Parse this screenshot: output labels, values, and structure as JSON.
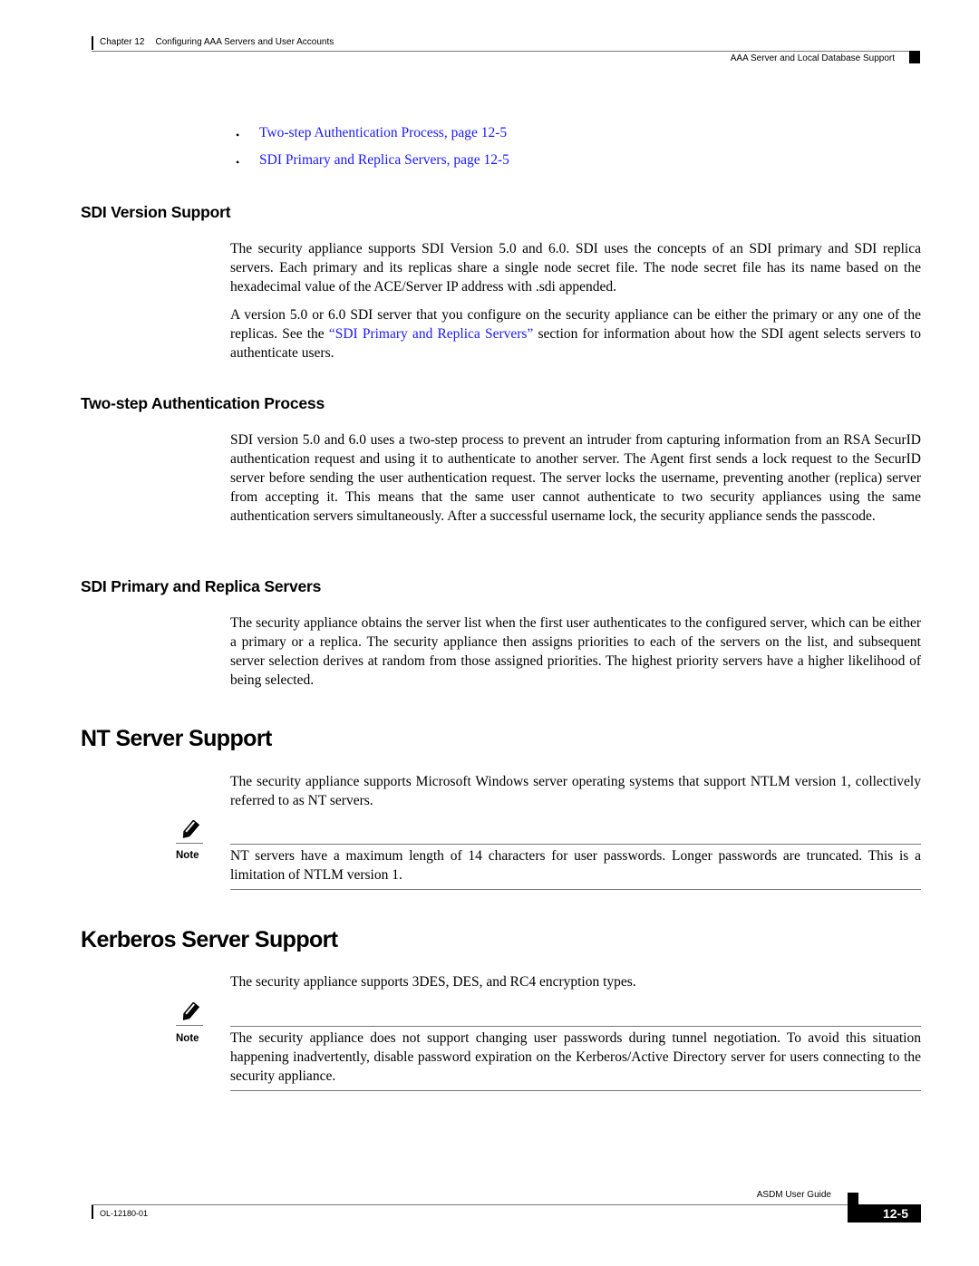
{
  "header": {
    "chapter_label": "Chapter 12",
    "chapter_title": "Configuring AAA Servers and User Accounts",
    "section_title": "AAA Server and Local Database Support"
  },
  "bullets": [
    {
      "text": "Two-step Authentication Process, page 12-5"
    },
    {
      "text": "SDI Primary and Replica Servers, page 12-5"
    }
  ],
  "sections": {
    "sdi_version": {
      "heading": "SDI Version Support",
      "para1": "The security appliance supports SDI Version 5.0 and 6.0. SDI uses the concepts of an SDI primary and SDI replica servers. Each primary and its replicas share a single node secret file. The node secret file has its name based on the hexadecimal value of the ACE/Server IP address with .sdi appended.",
      "para2_before": "A version 5.0 or 6.0 SDI server that you configure on the security appliance can be either the primary or any one of the replicas. See the ",
      "para2_link": "“SDI Primary and Replica Servers”",
      "para2_after": " section for information about how the SDI agent selects servers to authenticate users."
    },
    "two_step": {
      "heading": "Two-step Authentication Process",
      "para": "SDI version 5.0 and 6.0 uses a two-step process to prevent an intruder from capturing information from an RSA SecurID authentication request and using it to authenticate to another server. The Agent first sends a lock request to the SecurID server before sending the user authentication request. The server locks the username, preventing another (replica) server from accepting it. This means that the same user cannot authenticate to two security appliances using the same authentication servers simultaneously. After a successful username lock, the security appliance sends the passcode."
    },
    "sdi_primary": {
      "heading": "SDI Primary and Replica Servers",
      "para": "The security appliance obtains the server list when the first user authenticates to the configured server, which can be either a primary or a replica. The security appliance then assigns priorities to each of the servers on the list, and subsequent server selection derives at random from those assigned priorities. The highest priority servers have a higher likelihood of being selected."
    },
    "nt_server": {
      "heading": "NT Server Support",
      "para": "The security appliance supports Microsoft Windows server operating systems that support NTLM version 1, collectively referred to as NT servers.",
      "note_label": "Note",
      "note_text": "NT servers have a maximum length of 14 characters for user passwords. Longer passwords are truncated. This is a limitation of NTLM version 1."
    },
    "kerberos": {
      "heading": "Kerberos Server Support",
      "para": "The security appliance supports 3DES, DES, and RC4 encryption types.",
      "note_label": "Note",
      "note_text": "The security appliance does not support changing user passwords during tunnel negotiation. To avoid this situation happening inadvertently, disable password expiration on the Kerberos/Active Directory server for users connecting to the security appliance."
    }
  },
  "footer": {
    "guide_title": "ASDM User Guide",
    "doc_number": "OL-12180-01",
    "page_number": "12-5"
  },
  "icons": {
    "note": "pencil-note-icon"
  }
}
